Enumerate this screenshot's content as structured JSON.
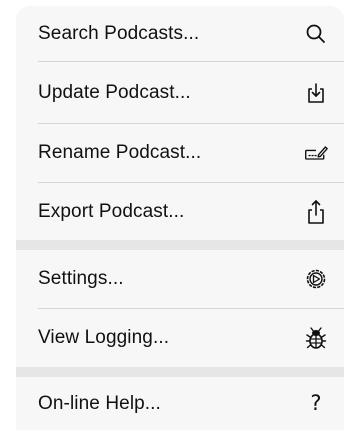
{
  "menu": {
    "items": [
      {
        "label": "Search Podcasts...",
        "icon": "search-icon"
      },
      {
        "label": "Update Podcast...",
        "icon": "download-tray-icon"
      },
      {
        "label": "Rename Podcast...",
        "icon": "rename-pencil-icon"
      },
      {
        "label": "Export Podcast...",
        "icon": "share-icon"
      },
      {
        "label": "Settings...",
        "icon": "settings-gear-icon"
      },
      {
        "label": "View Logging...",
        "icon": "bug-icon"
      },
      {
        "label": "On-line Help...",
        "icon": "help-icon",
        "glyph": "?"
      }
    ]
  }
}
